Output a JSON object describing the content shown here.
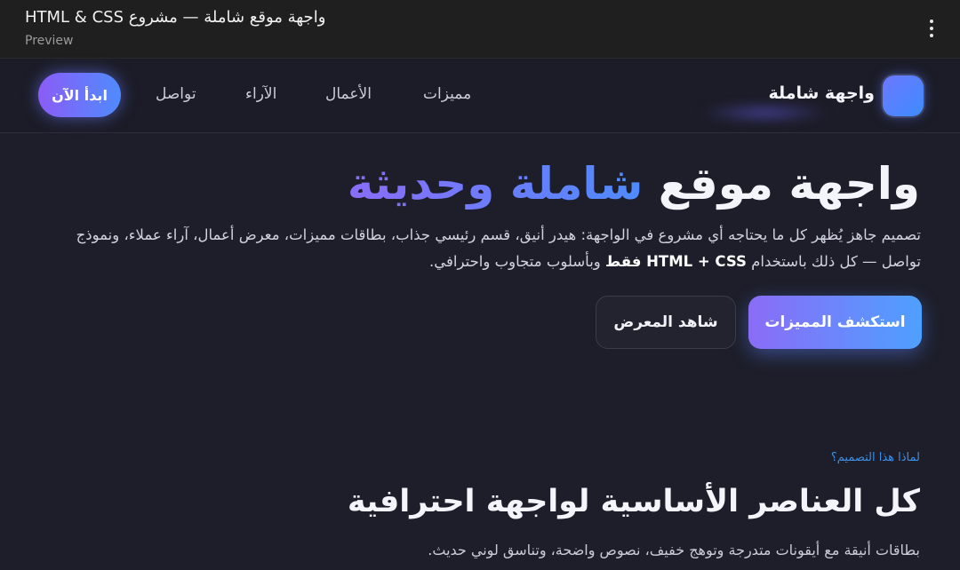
{
  "window": {
    "title": "واجهة موقع شاملة — مشروع HTML & CSS",
    "subtitle": "Preview"
  },
  "nav": {
    "brand": "واجهة شاملة",
    "links": [
      "مميزات",
      "الأعمال",
      "الآراء",
      "تواصل"
    ],
    "cta_label": "ابدأ الآن"
  },
  "hero": {
    "title_main": "واجهة موقع",
    "title_accent": "شاملة وحديثة",
    "desc_line1": "تصميم جاهز يُظهر كل ما يحتاجه أي مشروع في الواجهة: هيدر أنيق، قسم رئيسي جذاب، بطاقات مميزات، معرض أعمال، آراء عملاء، ونموذج",
    "desc_line2_pre": "تواصل — كل ذلك باستخدام",
    "desc_line2_bold": "HTML + CSS فقط",
    "desc_line2_post": "وبأسلوب متجاوب واحترافي.",
    "primary_button": "استكشف المميزات",
    "secondary_button": "شاهد المعرض"
  },
  "features": {
    "eyebrow": "لماذا هذا التصميم؟",
    "title": "كل العناصر الأساسية لواجهة احترافية",
    "description": "بطاقات أنيقة مع أيقونات متدرجة وتوهج خفيف، نصوص واضحة، وتناسق لوني حديث."
  },
  "colors": {
    "background": "#1d1e29",
    "accent_purple": "#8b5cf6",
    "accent_blue": "#4f8bff",
    "eyebrow_blue": "#3e8fe6"
  },
  "icons": {
    "menu": "more-vertical-icon",
    "logo": "logo-mark-icon"
  }
}
